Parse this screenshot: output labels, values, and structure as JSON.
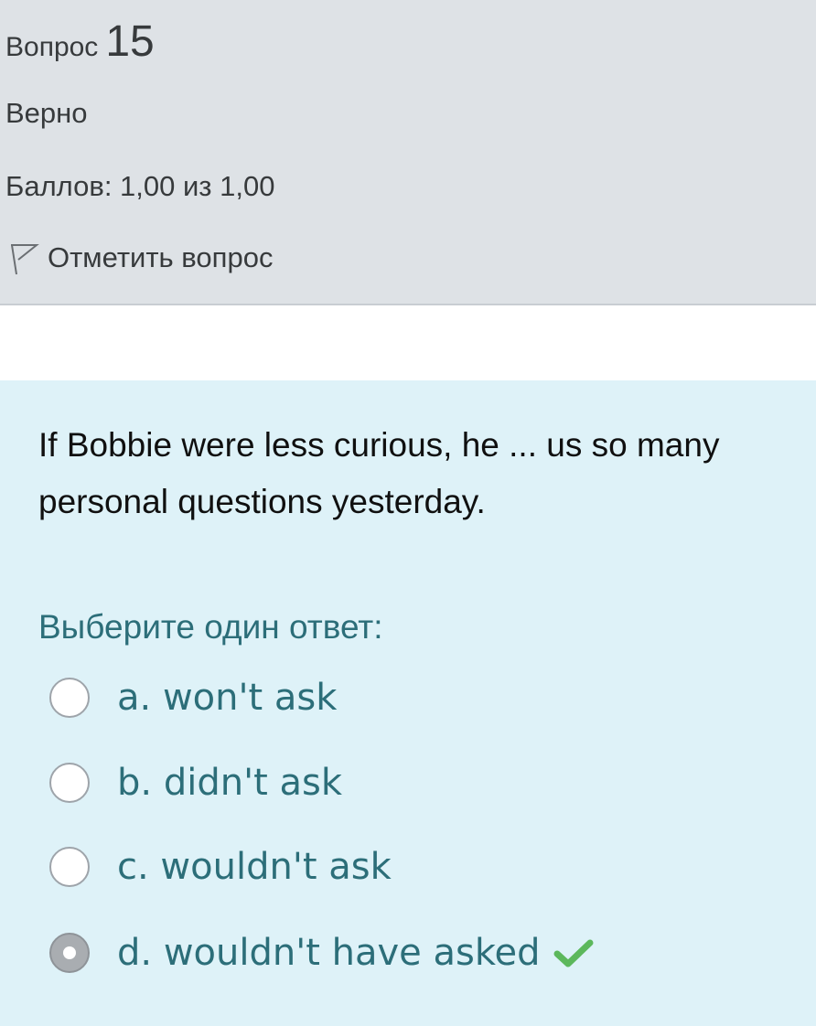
{
  "info": {
    "question_label": "Вопрос",
    "question_number": "15",
    "state": "Верно",
    "grade": "Баллов: 1,00 из 1,00",
    "flag_label": "Отметить вопрос",
    "flag_icon": "flag-outline-icon"
  },
  "question": {
    "text": "If Bobbie were less curious, he ... us so many personal questions yesterday.",
    "prompt": "Выберите один ответ:",
    "answers": [
      {
        "label": "a. won't ask",
        "selected": false
      },
      {
        "label": "b. didn't ask",
        "selected": false
      },
      {
        "label": "c. wouldn't ask",
        "selected": false
      },
      {
        "label": "d. wouldn't have asked",
        "selected": true,
        "correct": true
      }
    ],
    "correct_icon": "checkmark-icon"
  },
  "colors": {
    "info_bg": "#dee2e6",
    "content_bg": "#def2f8",
    "answer_text": "#2c6e79",
    "check": "#5cb85c"
  }
}
